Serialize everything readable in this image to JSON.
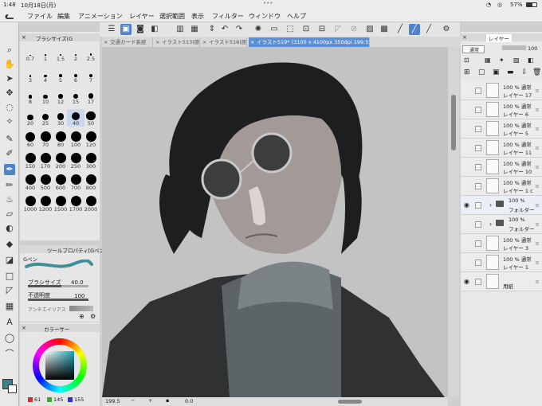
{
  "status": {
    "time": "1:48",
    "date": "10月18日(月)",
    "battery": "57%",
    "dots": "•••"
  },
  "menu": [
    "ファイル",
    "編集",
    "アニメーション",
    "レイヤー",
    "選択範囲",
    "表示",
    "フィルター",
    "ウィンドウ",
    "ヘルプ"
  ],
  "tabs": [
    {
      "label": "交通カード系統"
    },
    {
      "label": "イラスト513(原"
    },
    {
      "label": "イラスト516(原"
    },
    {
      "label": "イラスト519* (3100 x 4100px 350dpi 199.5%)"
    }
  ],
  "brush": {
    "title": "ブラシサイズ(G",
    "sizes": [
      "0.7",
      "1",
      "1.5",
      "2",
      "2.5",
      "3",
      "4",
      "5",
      "6",
      "7",
      "8",
      "10",
      "12",
      "15",
      "17",
      "20",
      "25",
      "30",
      "40",
      "50",
      "60",
      "70",
      "80",
      "100",
      "120",
      "150",
      "170",
      "200",
      "250",
      "300",
      "400",
      "500",
      "600",
      "700",
      "800",
      "1000",
      "1200",
      "1500",
      "1700",
      "2000"
    ]
  },
  "toolprop": {
    "title": "ツールプロパティ[Gペン]",
    "pen_name": "Gペン",
    "size_label": "ブラシサイズ",
    "size_value": "40.0",
    "opacity_label": "不透明度",
    "opacity_value": "100",
    "aa_label": "アンチエイリアス"
  },
  "color": {
    "title": "カラーサー",
    "r": "61",
    "g": "145",
    "b": "155",
    "main_color": "#3e7f8c",
    "sub_color": "#ffffff"
  },
  "bottom": {
    "zoom": "199.5",
    "angle": "0.0"
  },
  "layers": {
    "tab": "レイヤー",
    "blend": "通常",
    "opacity": "100",
    "rows": [
      {
        "op": "100 % 通常",
        "name": "レイヤー 17"
      },
      {
        "op": "100 % 通常",
        "name": "レイヤー 6"
      },
      {
        "op": "100 % 通常",
        "name": "レイヤー 5"
      },
      {
        "op": "100 % 通常",
        "name": "レイヤー 11"
      },
      {
        "op": "100 % 通常",
        "name": "レイヤー 10"
      },
      {
        "op": "100 % 通常",
        "name": "レイヤー 1 c"
      },
      {
        "op": "100 %",
        "name": "フォルダー"
      },
      {
        "op": "100 %",
        "name": "フォルダー"
      },
      {
        "op": "100 % 通常",
        "name": "レイヤー 3"
      },
      {
        "op": "100 % 通常",
        "name": "レイヤー 1"
      },
      {
        "op": "",
        "name": "用紙"
      }
    ]
  }
}
